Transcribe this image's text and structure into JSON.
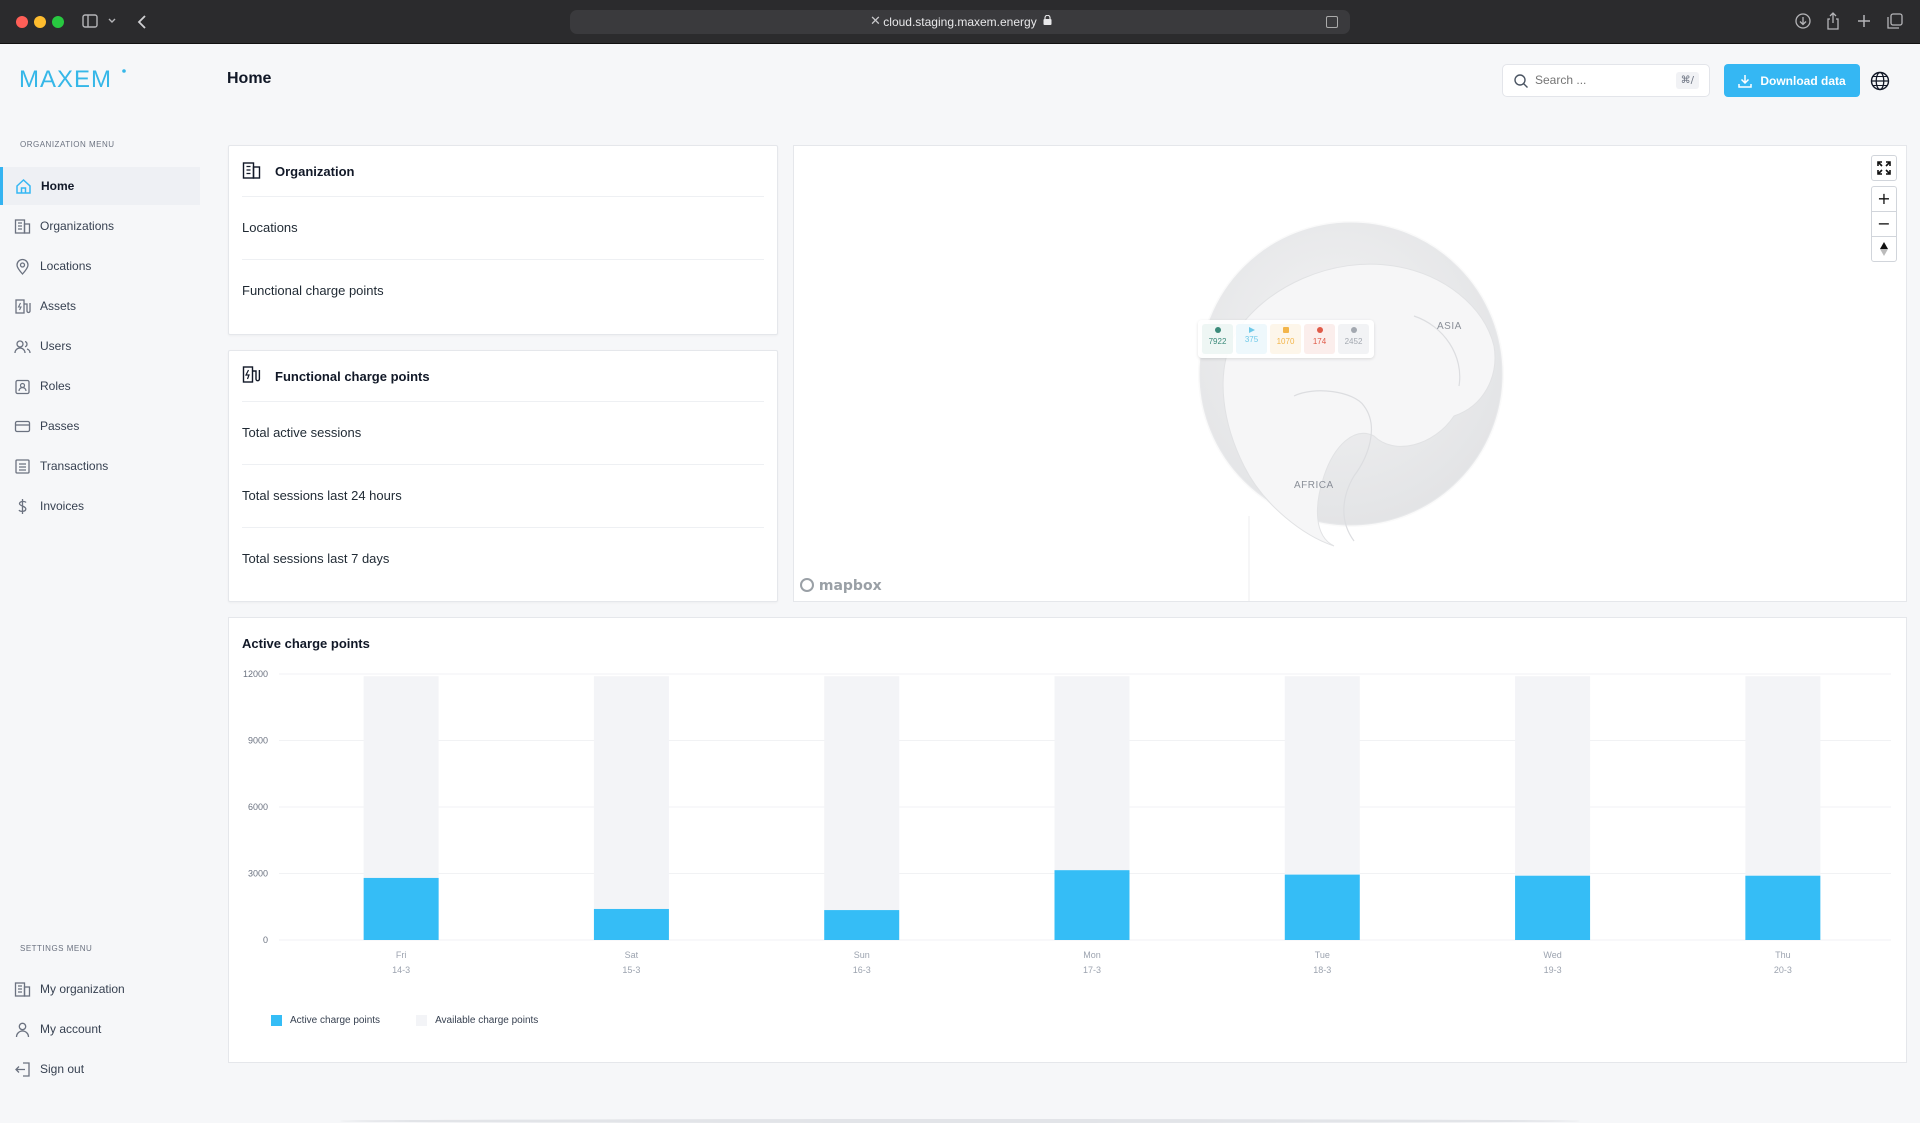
{
  "browser": {
    "url": "cloud.staging.maxem.energy",
    "icons": [
      "sidebar-toggle-icon",
      "chevron-down-icon",
      "back-icon",
      "download-icon",
      "share-icon",
      "new-tab-icon",
      "tabs-icon"
    ]
  },
  "brand": {
    "logo_text": "MAXEM",
    "accent": "#35b7f3"
  },
  "sidebar": {
    "org_menu_heading": "ORGANIZATION MENU",
    "org_items": [
      {
        "label": "Home",
        "icon": "home-icon",
        "active": true
      },
      {
        "label": "Organizations",
        "icon": "building-icon"
      },
      {
        "label": "Locations",
        "icon": "map-pin-icon"
      },
      {
        "label": "Assets",
        "icon": "charge-point-icon"
      },
      {
        "label": "Users",
        "icon": "users-icon"
      },
      {
        "label": "Roles",
        "icon": "id-badge-icon"
      },
      {
        "label": "Passes",
        "icon": "card-icon"
      },
      {
        "label": "Transactions",
        "icon": "list-icon"
      },
      {
        "label": "Invoices",
        "icon": "dollar-icon"
      }
    ],
    "settings_menu_heading": "SETTINGS MENU",
    "settings_items": [
      {
        "label": "My organization",
        "icon": "building-icon"
      },
      {
        "label": "My account",
        "icon": "user-icon"
      },
      {
        "label": "Sign out",
        "icon": "sign-out-icon"
      }
    ]
  },
  "header": {
    "title": "Home",
    "search": {
      "placeholder": "Search ...",
      "shortcut": "⌘/"
    },
    "download_label": "Download data"
  },
  "organization_card": {
    "title": "Organization",
    "rows": [
      "Locations",
      "Functional charge points"
    ]
  },
  "functional_card": {
    "title": "Functional charge points",
    "rows": [
      "Total active sessions",
      "Total sessions last 24 hours",
      "Total sessions last 7 days"
    ]
  },
  "map": {
    "labels": {
      "asia": "ASIA",
      "africa": "AFRICA"
    },
    "attribution": "mapbox",
    "cluster": [
      {
        "value": "7922",
        "color": "#3b8a7a",
        "bg": "#eef6f4"
      },
      {
        "value": "375",
        "color": "#6ec9e8",
        "bg": "#eef8fc"
      },
      {
        "value": "1070",
        "color": "#f3b54a",
        "bg": "#fdf6ea"
      },
      {
        "value": "174",
        "color": "#e05a48",
        "bg": "#fbeeec"
      },
      {
        "value": "2452",
        "color": "#a3a8b0",
        "bg": "#f2f3f5"
      }
    ]
  },
  "chart_card": {
    "title": "Active charge points",
    "legend": {
      "active": "Active charge points",
      "available": "Available charge points"
    }
  },
  "chart_data": {
    "type": "bar",
    "stacked": true,
    "title": "Active charge points",
    "categories": [
      "Fri 14-3",
      "Sat 15-3",
      "Sun 16-3",
      "Mon 17-3",
      "Tue 18-3",
      "Wed 19-3",
      "Thu 20-3"
    ],
    "day_labels": [
      "Fri",
      "Sat",
      "Sun",
      "Mon",
      "Tue",
      "Wed",
      "Thu"
    ],
    "date_labels": [
      "14-3",
      "15-3",
      "16-3",
      "17-3",
      "18-3",
      "19-3",
      "20-3"
    ],
    "series": [
      {
        "name": "Active charge points",
        "color": "#35bdf6",
        "values": [
          2800,
          1400,
          1350,
          3150,
          2950,
          2900,
          2900
        ]
      },
      {
        "name": "Available charge points",
        "color": "#f3f4f7",
        "values": [
          9100,
          10500,
          10550,
          8750,
          8950,
          9000,
          9000
        ]
      }
    ],
    "y_ticks": [
      "0",
      "3000",
      "6000",
      "9000",
      "12000"
    ],
    "ylim": [
      0,
      12000
    ],
    "grid": true,
    "legend_position": "bottom-left"
  }
}
